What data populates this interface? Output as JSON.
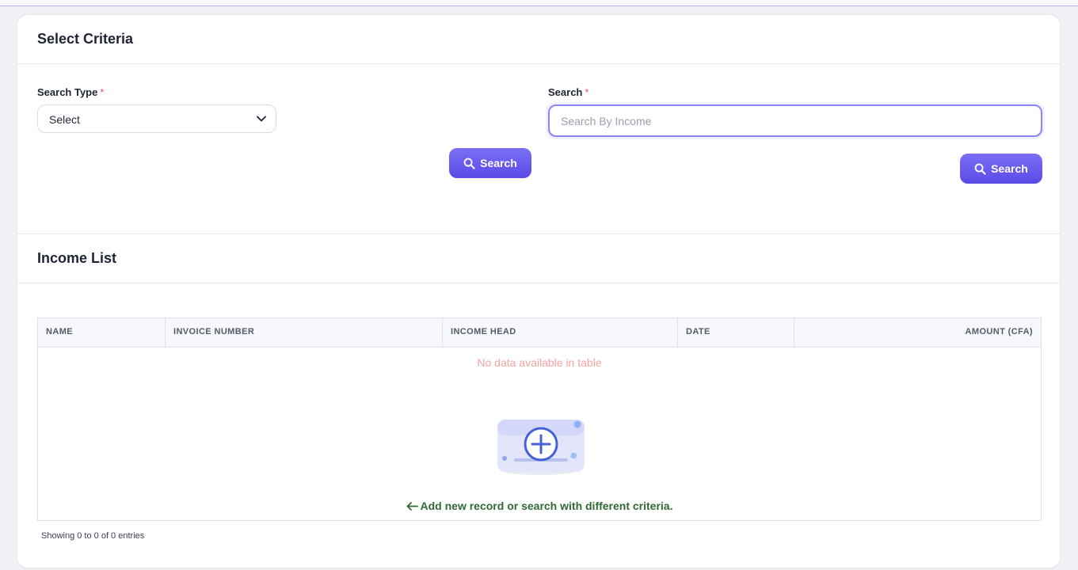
{
  "criteria": {
    "title": "Select Criteria",
    "search_type_label": "Search Type",
    "search_type_value": "Select",
    "search_label": "Search",
    "search_placeholder": "Search By Income",
    "required_mark": "*",
    "search_button_label": "Search"
  },
  "income_list": {
    "title": "Income List",
    "columns": [
      "NAME",
      "INVOICE NUMBER",
      "INCOME HEAD",
      "DATE",
      "AMOUNT (CFA)"
    ],
    "empty_message": "No data available in table",
    "hint": "Add new record or search with different criteria.",
    "info": "Showing 0 to 0 of 0 entries"
  },
  "icons": {
    "dropdown": "chevron-down-icon",
    "search": "magnifier-icon",
    "hint": "arrow-left-icon",
    "empty": "add-record-illustration"
  },
  "colors": {
    "accent": "#6a5cf0",
    "empty_text": "#f3a3a3",
    "hint_text": "#2f6b2f",
    "required": "#e4505a"
  }
}
